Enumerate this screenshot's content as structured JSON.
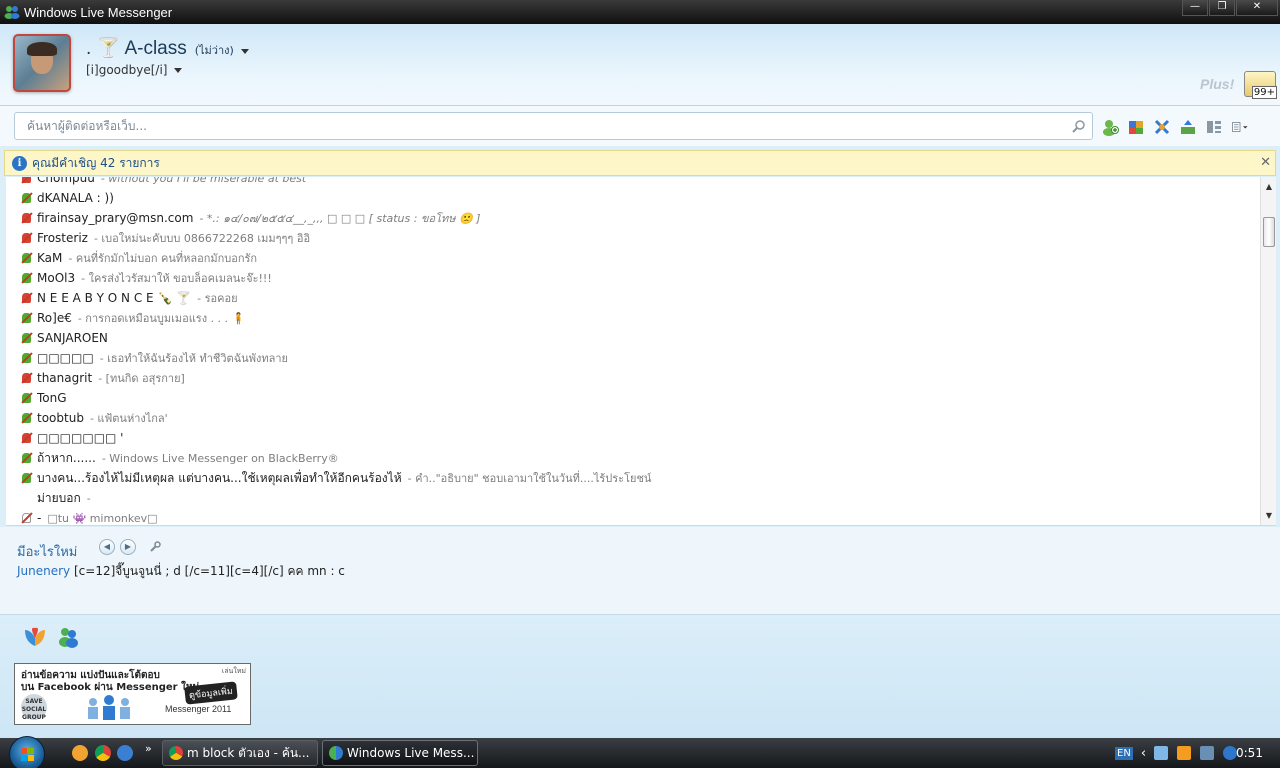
{
  "window": {
    "title": "Windows Live Messenger",
    "min_glyph": "—",
    "max_glyph": "❐",
    "close_glyph": "✕"
  },
  "profile": {
    "display_name": ". 🍸 A-class",
    "status": "(ไม่ว่าง)",
    "personal_message": "[i]goodbye[/i]",
    "plus_label": "Plus!",
    "mail_count": "99+"
  },
  "search": {
    "placeholder": "ค้นหาผู้ติดต่อหรือเว็บ..."
  },
  "notification": {
    "text": "คุณมีคำเชิญ 42 รายการ",
    "info_glyph": "i",
    "close_glyph": "✕"
  },
  "contacts": [
    {
      "name": "Chompuu",
      "message": "- without you I'll be miserable at best",
      "status": "busy",
      "italic": true
    },
    {
      "name": "dKANALA : ))",
      "message": "",
      "status": "online",
      "italic": false
    },
    {
      "name": "firainsay_prary@msn.com",
      "message": "- *.: ๑๔/๐๗/๒๕๕๔__,_,,, □ □ □ [ status : ขอโทษ 🙁 ]",
      "status": "busy",
      "italic": true
    },
    {
      "name": "Frosteriz",
      "message": "- เบอใหม่นะคับบบ  0866722268  เมมๆๆๆ อิอิ",
      "status": "busy",
      "italic": false
    },
    {
      "name": "KaM",
      "message": "- คนที่รักมักไม่บอก คนที่หลอกมักบอกรัก",
      "status": "online",
      "italic": false
    },
    {
      "name": "MoOl3",
      "message": "- ใครส่งไวรัสมาให้ ขอบล็อคเมลนะจ๊ะ!!!",
      "status": "online",
      "italic": false
    },
    {
      "name": "N E E A B Y O N C E  🍾 🍸",
      "message": "- รอคอย",
      "status": "busy",
      "italic": false
    },
    {
      "name": "Ro]e€",
      "message": "- การกอดเหมือนบูมเมอแรง . . . 🧍",
      "status": "online",
      "italic": false
    },
    {
      "name": "SANJAROEN",
      "message": "",
      "status": "online",
      "italic": false
    },
    {
      "name": "□□□□□",
      "message": "- เธอทำให้ฉันร้องไห้ ทำชีวิตฉันพังทลาย",
      "status": "online",
      "italic": false
    },
    {
      "name": "thanagrit",
      "message": "- [ทนกิด อสุรกาย]",
      "status": "busy",
      "italic": false
    },
    {
      "name": "TonG",
      "message": "",
      "status": "online",
      "italic": false
    },
    {
      "name": "toobtub",
      "message": "- แฟ้ตนห่างไกล'",
      "status": "online",
      "italic": false
    },
    {
      "name": "□□□□□□□ '",
      "message": "",
      "status": "busy",
      "italic": false
    },
    {
      "name": "ถ้าหาก......",
      "message": "- Windows Live Messenger on BlackBerry®",
      "status": "online",
      "italic": false
    },
    {
      "name": "บางคน...ร้องไห้ไม่มีเหตุผล  แต่บางคน...ใช้เหตุผลเพื่อทำให้อีกคนร้องไห้",
      "message": "- คำ..\"อธิบาย\" ชอบเอามาใช้ในวันที่....ไร้ประโยชน์",
      "status": "online",
      "italic": false
    },
    {
      "name": "ม่ายบอก",
      "message": "-",
      "status": "none",
      "italic": false
    },
    {
      "name": "-",
      "message": "□tu 👾   mimonkev□",
      "status": "offline",
      "italic": false
    }
  ],
  "whats_new": {
    "title": "มีอะไรใหม่",
    "prev_glyph": "◀",
    "next_glyph": "▶",
    "author": "Junenery",
    "text": "[c=12]จี๊บูนจูนนี่ ; d [/c=11][c=4][/c] คค mn : c"
  },
  "ad": {
    "line1": "อ่านข้อความ แบ่งปันและโต้ตอบ",
    "line2": "บน Facebook ผ่าน Messenger ใหม่",
    "cta": "ดูข้อมูลเพิ่ม",
    "small": "เล่นใหม่",
    "save_badge": "SAVE SOCIAL GROUP",
    "brand": "Messenger 2011"
  },
  "taskbar": {
    "more_glyph": "»",
    "tasks": [
      {
        "label": "m block ตัวเอง - ค้น..."
      },
      {
        "label": "Windows Live Mess..."
      }
    ],
    "lang": "EN",
    "tray_arrow": "‹",
    "clock": "0:51"
  }
}
